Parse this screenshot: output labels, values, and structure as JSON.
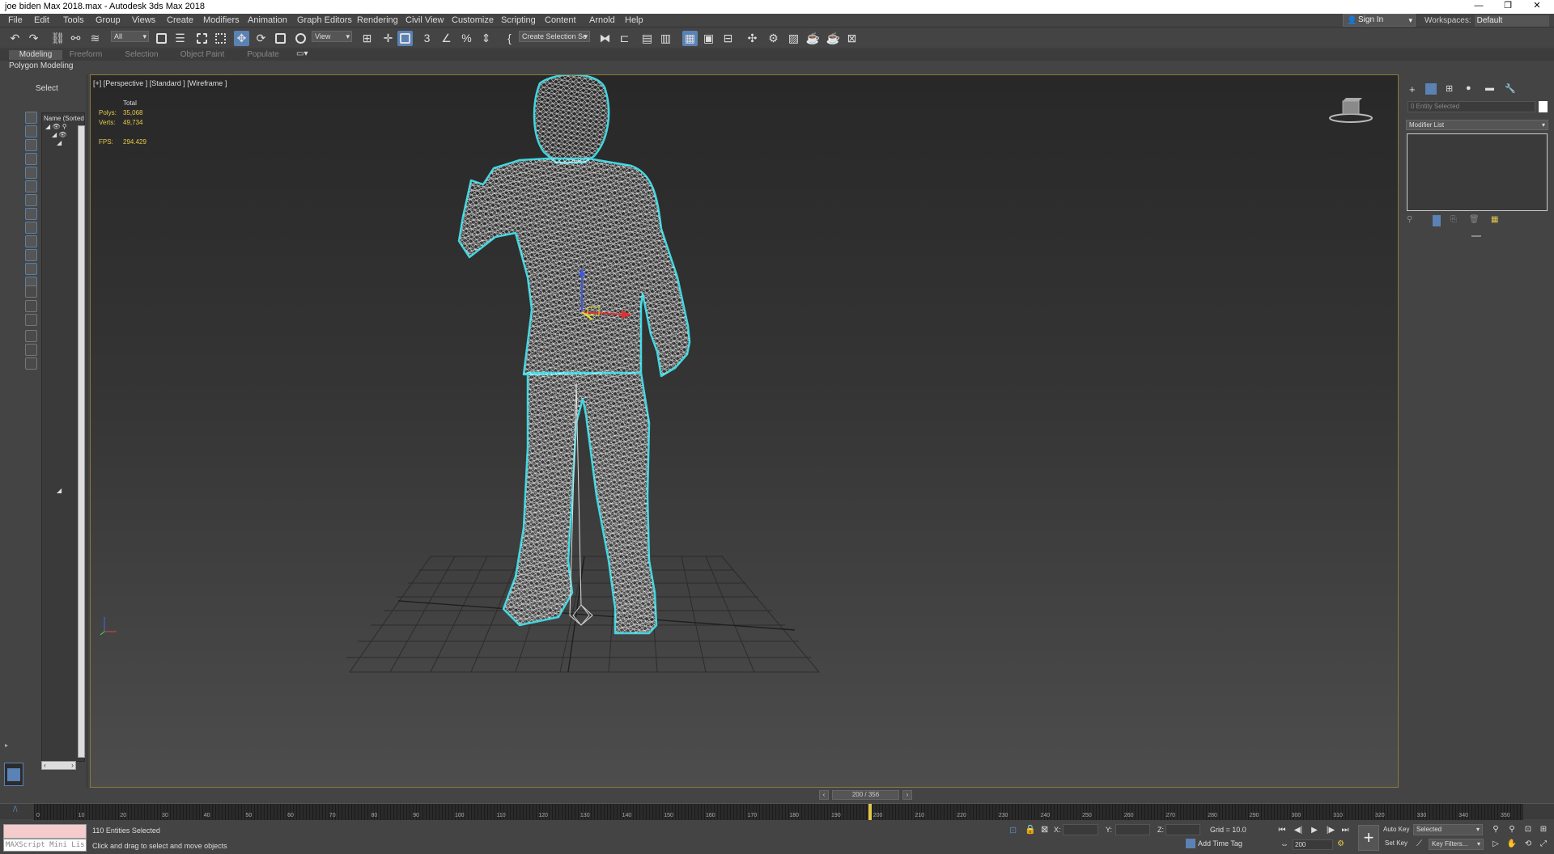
{
  "window": {
    "title": "joe biden Max 2018.max - Autodesk 3ds Max 2018",
    "minimize_glyph": "—",
    "restore_glyph": "❐",
    "close_glyph": "✕"
  },
  "menu": {
    "items": [
      "File",
      "Edit",
      "Tools",
      "Group",
      "Views",
      "Create",
      "Modifiers",
      "Animation",
      "Graph Editors",
      "Rendering",
      "Civil View",
      "Customize",
      "Scripting",
      "Content",
      "Arnold",
      "Help"
    ],
    "sign_in": "Sign In",
    "workspaces_label": "Workspaces:",
    "workspaces_value": "Default"
  },
  "toolbar": {
    "selection_filter": "All",
    "ref_coord": "View",
    "named_selection": "Create Selection Se"
  },
  "ribbon": {
    "tabs": [
      "Modeling",
      "Freeform",
      "Selection",
      "Object Paint",
      "Populate"
    ],
    "active_tab": "Modeling",
    "sub_label": "Polygon Modeling"
  },
  "scene_explorer": {
    "title": "Select",
    "header": "Name (Sorted A"
  },
  "viewport": {
    "label": "[+] [Perspective ] [Standard ] [Wireframe ]",
    "stats": {
      "total_label": "Total",
      "polys_label": "Polys:",
      "polys_value": "35,068",
      "verts_label": "Verts:",
      "verts_value": "49,734",
      "fps_label": "FPS:",
      "fps_value": "294.429"
    }
  },
  "command_panel": {
    "name_placeholder": "0 Entity Selected",
    "modifier_list": "Modifier List"
  },
  "timeline": {
    "slider": "200 / 356",
    "ticks": [
      "0",
      "10",
      "20",
      "30",
      "40",
      "50",
      "60",
      "70",
      "80",
      "90",
      "100",
      "110",
      "120",
      "130",
      "140",
      "150",
      "160",
      "170",
      "180",
      "190",
      "200",
      "210",
      "220",
      "230",
      "240",
      "250",
      "260",
      "270",
      "280",
      "290",
      "300",
      "310",
      "320",
      "330",
      "340",
      "350"
    ]
  },
  "status": {
    "maxscript": "MAXScript Mini Lis",
    "selection": "110 Entities Selected",
    "hint": "Click and drag to select and move objects",
    "x_label": "X:",
    "y_label": "Y:",
    "z_label": "Z:",
    "grid": "Grid = 10.0",
    "add_time_tag": "Add Time Tag",
    "frame": "200",
    "auto_key": "Auto Key",
    "set_key": "Set Key",
    "selected": "Selected",
    "key_filters": "Key Filters..."
  },
  "colors": {
    "accent": "#5a82b4",
    "wire_highlight": "#3fd6e0",
    "stats_text": "#e8c94a",
    "viewport_border": "#8a7a3a"
  }
}
